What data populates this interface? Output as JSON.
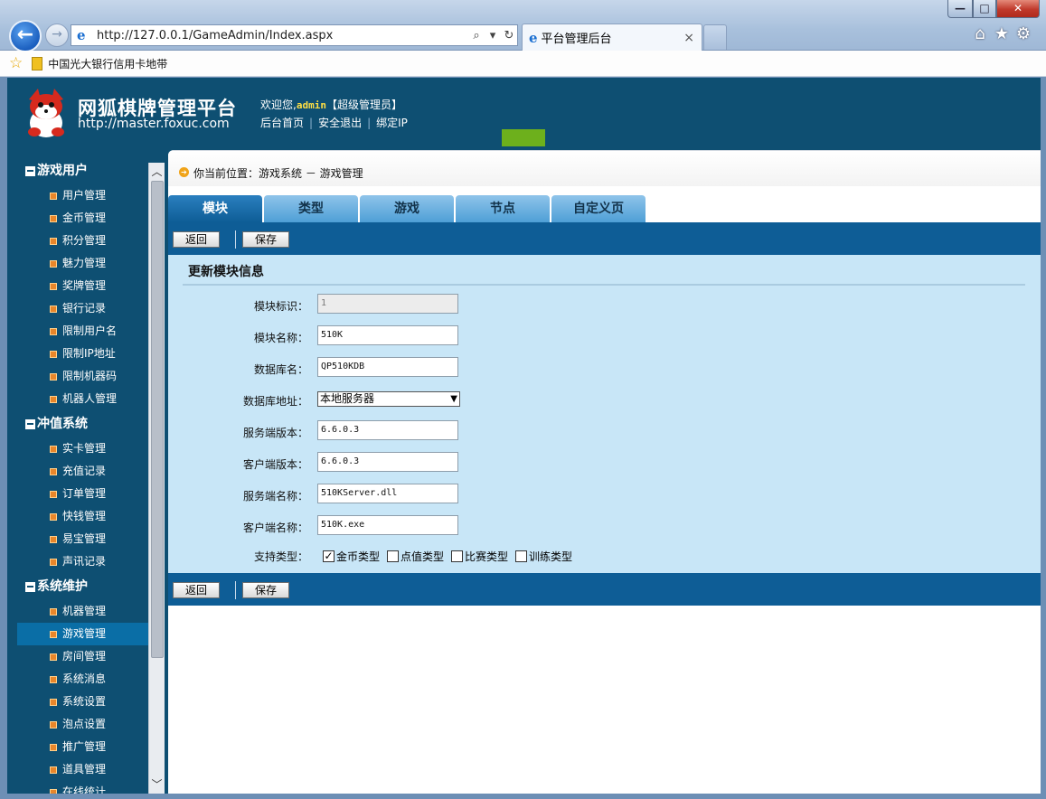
{
  "browser": {
    "address_url": "http://127.0.0.1/GameAdmin/Index.aspx",
    "tab_title": "平台管理后台",
    "tab_close": "×",
    "favorite_label": "中国光大银行信用卡地带",
    "win_min": "—",
    "win_max": "□",
    "win_close": "✕",
    "back": "←",
    "forward": "→",
    "search_glyph": "⌕",
    "refresh_glyph": "↻",
    "home_glyph": "⌂",
    "star_glyph": "★",
    "gear_glyph": "⚙",
    "fav_star": "☆"
  },
  "header": {
    "title": "网狐棋牌管理平台",
    "url": "http://master.foxuc.com",
    "welcome_prefix": "欢迎您,",
    "username": "admin",
    "role": "【超级管理员】",
    "links": [
      "后台首页",
      "安全退出",
      "绑定IP"
    ],
    "accent_color": "#6db01c"
  },
  "sidebar": {
    "groups": [
      {
        "title": "游戏用户",
        "items": [
          "用户管理",
          "金币管理",
          "积分管理",
          "魅力管理",
          "奖牌管理",
          "银行记录",
          "限制用户名",
          "限制IP地址",
          "限制机器码",
          "机器人管理"
        ]
      },
      {
        "title": "冲值系统",
        "items": [
          "实卡管理",
          "充值记录",
          "订单管理",
          "快钱管理",
          "易宝管理",
          "声讯记录"
        ]
      },
      {
        "title": "系统维护",
        "items": [
          "机器管理",
          "游戏管理",
          "房间管理",
          "系统消息",
          "系统设置",
          "泡点设置",
          "推广管理",
          "道具管理",
          "在线统计"
        ]
      }
    ],
    "active_item": "游戏管理"
  },
  "breadcrumb": "你当前位置：游戏系统 － 游戏管理",
  "tabs": [
    "模块",
    "类型",
    "游戏",
    "节点",
    "自定义页"
  ],
  "active_tab": "模块",
  "buttons": {
    "back": "返回",
    "save": "保存"
  },
  "form": {
    "title": "更新模块信息",
    "fields": [
      {
        "label": "模块标识：",
        "value": "1"
      },
      {
        "label": "模块名称：",
        "value": "510K"
      },
      {
        "label": "数据库名：",
        "value": "QP510KDB"
      },
      {
        "label": "数据库地址：",
        "value": "本地服务器"
      },
      {
        "label": "服务端版本：",
        "value": "6.6.0.3"
      },
      {
        "label": "客户端版本：",
        "value": "6.6.0.3"
      },
      {
        "label": "服务端名称：",
        "value": "510KServer.dll"
      },
      {
        "label": "客户端名称：",
        "value": "510K.exe"
      }
    ],
    "support_label": "支持类型：",
    "support_types": [
      {
        "label": "金币类型",
        "checked": true
      },
      {
        "label": "点值类型",
        "checked": false
      },
      {
        "label": "比赛类型",
        "checked": false
      },
      {
        "label": "训练类型",
        "checked": false
      }
    ]
  }
}
